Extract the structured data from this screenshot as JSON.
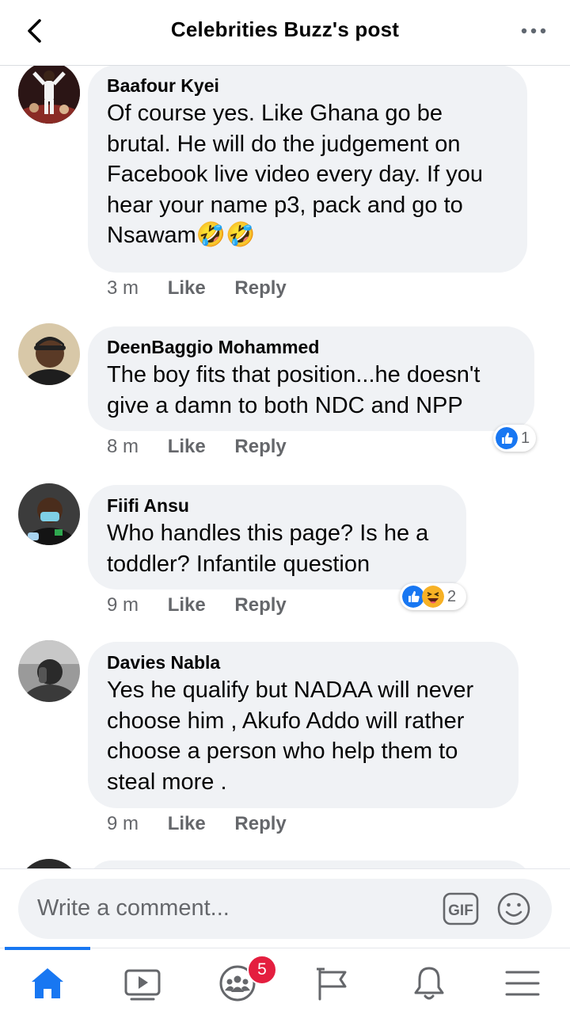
{
  "header": {
    "title": "Celebrities Buzz's post"
  },
  "comments": [
    {
      "author": "Baafour Kyei",
      "text": "Of course yes. Like Ghana go be brutal. He will do the judgement on Facebook live video every day. If you hear your name p3, pack and go to Nsawam",
      "emoji": "🤣🤣",
      "time": "3 m",
      "like_label": "Like",
      "reply_label": "Reply"
    },
    {
      "author": "DeenBaggio Mohammed",
      "text": "The boy fits that position...he doesn't give a damn to both NDC and NPP",
      "time": "8 m",
      "like_label": "Like",
      "reply_label": "Reply",
      "reaction_count": "1",
      "reactions": [
        "like"
      ]
    },
    {
      "author": "Fiifi Ansu",
      "text": "Who handles this page? Is he a toddler? Infantile question",
      "time": "9 m",
      "like_label": "Like",
      "reply_label": "Reply",
      "reaction_count": "2",
      "reactions": [
        "like",
        "haha"
      ]
    },
    {
      "author": "Davies Nabla",
      "text": "Yes he qualify but NADAA will never choose him , Akufo Addo will rather choose a person who help them to steal more .",
      "time": "9 m",
      "like_label": "Like",
      "reply_label": "Reply"
    }
  ],
  "composer": {
    "placeholder": "Write a comment...",
    "gif_label": "GIF"
  },
  "nav": {
    "items": [
      "home-icon",
      "video-icon",
      "groups-icon",
      "pages-flag-icon",
      "notifications-bell-icon",
      "menu-icon"
    ],
    "groups_badge": "5",
    "active": "home-icon"
  },
  "colors": {
    "accent": "#1877f2",
    "bubble": "#f0f2f5",
    "secondary_text": "#65676b",
    "badge": "#e41e3f"
  }
}
